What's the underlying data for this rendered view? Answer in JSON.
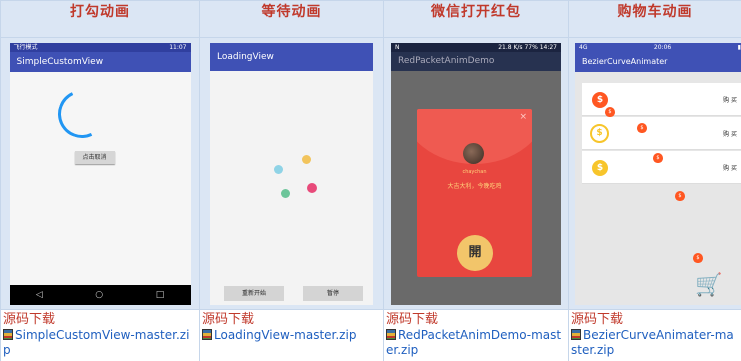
{
  "headers": [
    "打勾动画",
    "等待动画",
    "微信打开红包",
    "购物车动画"
  ],
  "phones": {
    "p1": {
      "status_left": "飞行模式",
      "status_right": "11:07",
      "title": "SimpleCustomView",
      "button": "点击取消",
      "nav": [
        "◁",
        "○",
        "□"
      ]
    },
    "p2": {
      "title": "LoadingView",
      "buttons": [
        "重新开始",
        "暂停"
      ]
    },
    "p3": {
      "status_left": "N",
      "status_right": "21.8 K/s  77%  14:27",
      "title": "RedPacketAnimDemo",
      "close": "×",
      "name": "chaychan",
      "wish": "大吉大利，今晚吃鸡",
      "open": "開"
    },
    "p4": {
      "status_left": "4G",
      "status_mid": "20:06",
      "title": "BezierCurveAnimater",
      "buy": [
        "购 买",
        "购 买",
        "购 买"
      ]
    }
  },
  "downloads": {
    "label": "源码下载",
    "files": [
      "SimpleCustomView-master.zip",
      "LoadingView-master.zip",
      "RedPacketAnimDemo-master.zip",
      "BezierCurveAnimater-master.zip"
    ]
  },
  "colors": {
    "header_text": "#c0392b",
    "link": "#1f5fbf",
    "accent_blue": "#3f51b5",
    "red_packet": "#e8463f"
  }
}
